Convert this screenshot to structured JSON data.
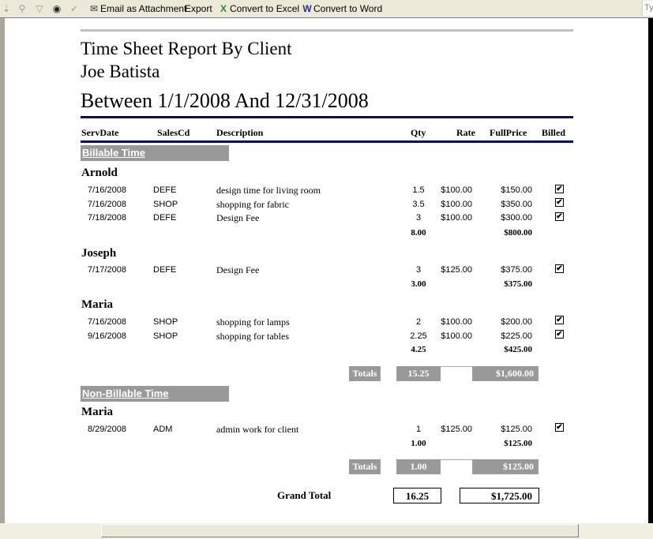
{
  "toolbar": {
    "email_label": "Email as Attachment",
    "export_label": "Export",
    "excel_label": "Convert to Excel",
    "word_label": "Convert to Word",
    "search_placeholder": "Ty"
  },
  "report": {
    "title": "Time Sheet Report By Client",
    "person": "Joe Batista",
    "range": "Between 1/1/2008 And 12/31/2008",
    "columns": [
      "ServDate",
      "SalesCd",
      "Description",
      "Qty",
      "Rate",
      "FullPrice",
      "Billed"
    ],
    "sections": [
      {
        "label": "Billable Time",
        "clients": [
          {
            "name": "Arnold",
            "rows": [
              {
                "date": "7/16/2008",
                "code": "DEFE",
                "desc": "design time for living room",
                "qty": "1.5",
                "rate": "$100.00",
                "price": "$150.00",
                "billed": true
              },
              {
                "date": "7/16/2008",
                "code": "SHOP",
                "desc": "shopping for fabric",
                "qty": "3.5",
                "rate": "$100.00",
                "price": "$350.00",
                "billed": true
              },
              {
                "date": "7/18/2008",
                "code": "DEFE",
                "desc": "Design Fee",
                "qty": "3",
                "rate": "$100.00",
                "price": "$300.00",
                "billed": true
              }
            ],
            "subtotal_qty": "8.00",
            "subtotal_price": "$800.00"
          },
          {
            "name": "Joseph",
            "rows": [
              {
                "date": "7/17/2008",
                "code": "DEFE",
                "desc": "Design Fee",
                "qty": "3",
                "rate": "$125.00",
                "price": "$375.00",
                "billed": true
              }
            ],
            "subtotal_qty": "3.00",
            "subtotal_price": "$375.00"
          },
          {
            "name": "Maria",
            "rows": [
              {
                "date": "7/16/2008",
                "code": "SHOP",
                "desc": "shopping for lamps",
                "qty": "2",
                "rate": "$100.00",
                "price": "$200.00",
                "billed": true
              },
              {
                "date": "9/16/2008",
                "code": "SHOP",
                "desc": "shopping for tables",
                "qty": "2.25",
                "rate": "$100.00",
                "price": "$225.00",
                "billed": true
              }
            ],
            "subtotal_qty": "4.25",
            "subtotal_price": "$425.00"
          }
        ],
        "totals_label": "Totals",
        "total_qty": "15.25",
        "total_price": "$1,600.00"
      },
      {
        "label": "Non-Billable Time",
        "clients": [
          {
            "name": "Maria",
            "rows": [
              {
                "date": "8/29/2008",
                "code": "ADM",
                "desc": "admin work for client",
                "qty": "1",
                "rate": "$125.00",
                "price": "$125.00",
                "billed": true
              }
            ],
            "subtotal_qty": "1.00",
            "subtotal_price": "$125.00"
          }
        ],
        "totals_label": "Totals",
        "total_qty": "1.00",
        "total_price": "$125.00"
      }
    ],
    "grand_total_label": "Grand Total",
    "grand_total_qty": "16.25",
    "grand_total_price": "$1,725.00",
    "check_glyph": "✔"
  }
}
